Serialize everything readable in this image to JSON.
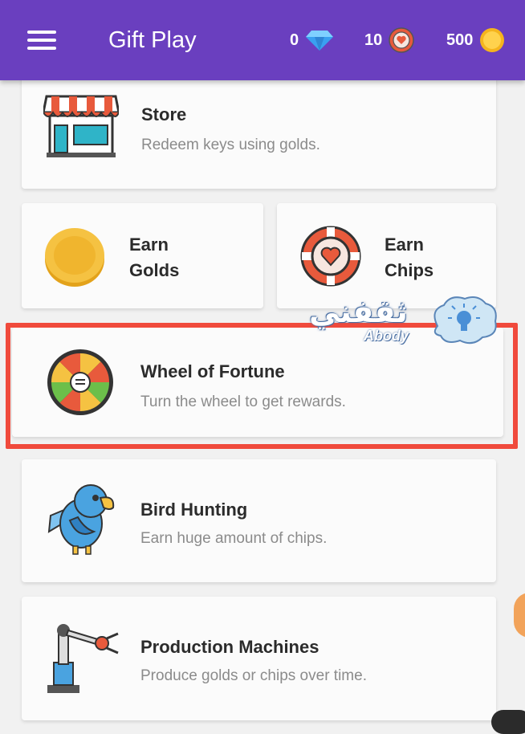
{
  "appbar": {
    "title": "Gift Play",
    "gems": "0",
    "chips": "10",
    "golds": "500"
  },
  "cards": {
    "store": {
      "title": "Store",
      "subtitle": "Redeem keys using golds."
    },
    "earn_golds": {
      "line1": "Earn",
      "line2": "Golds"
    },
    "earn_chips": {
      "line1": "Earn",
      "line2": "Chips"
    },
    "wheel": {
      "title": "Wheel of Fortune",
      "subtitle": "Turn the wheel to get rewards."
    },
    "bird": {
      "title": "Bird Hunting",
      "subtitle": "Earn huge amount of chips."
    },
    "machines": {
      "title": "Production Machines",
      "subtitle": "Produce golds or chips over time."
    }
  },
  "watermark": {
    "arabic": "ثقفني",
    "latin": "Abody"
  },
  "colors": {
    "appbar": "#6a3fbf",
    "highlight": "#f04a3c",
    "gold": "#f5c242",
    "chip": "#e85a3c",
    "diamond": "#3aa0f0"
  }
}
